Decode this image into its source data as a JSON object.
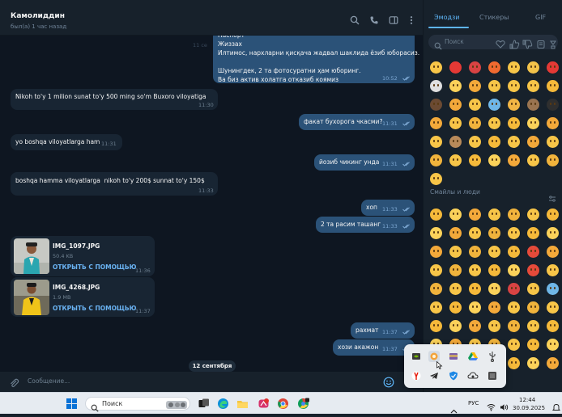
{
  "chat": {
    "name": "Камолиддин",
    "status": "был(а) 1 час назад",
    "input_placeholder": "Сообщение...",
    "date_separator": "12 сентября"
  },
  "messages": [
    {
      "dir": "out",
      "text": "Паспорт\nЖиззах\nИлтимос, нархларни қисқача жадвал шаклида ёзиб юборасиз.\n\nШунингдек, 2 та фотосуратни ҳам юборинг.\nВа биз актив холатга отказиб коямиз",
      "time": "10:52"
    },
    {
      "dir": "in",
      "text": "Nikoh to'y 1 milion sunat to'y 500 ming so'm Buxoro viloyatiga",
      "time": "11:30"
    },
    {
      "dir": "out",
      "text": "факат бухорога чкасми?",
      "time": "11:31"
    },
    {
      "dir": "in",
      "text": "yo boshqa viloyatlarga ham",
      "time": "11:31"
    },
    {
      "dir": "out",
      "text": "йозиб чикинг унда",
      "time": "11:31"
    },
    {
      "dir": "in",
      "text": "boshqa hamma viloyatlarga  nikoh to'y 200$ sunnat to'y 150$",
      "time": "11:33"
    },
    {
      "dir": "out",
      "text": "хоп",
      "time": "11:33"
    },
    {
      "dir": "out",
      "text": "2 та расим ташанг",
      "time": "11:33"
    },
    {
      "dir": "out",
      "text": "рахмат",
      "time": "11:37"
    },
    {
      "dir": "out",
      "text": "хози акажон",
      "time": "11:37"
    }
  ],
  "files": [
    {
      "name": "IMG_1097.JPG",
      "size": "50.4 KB",
      "action": "ОТКРЫТЬ С ПОМОЩЬЮ",
      "time": "11:36"
    },
    {
      "name": "IMG_4268.JPG",
      "size": "1.9 MB",
      "action": "ОТКРЫТЬ С ПОМОЩЬЮ",
      "time": "11:37"
    }
  ],
  "faded_time": "11 се",
  "emoji_panel": {
    "tabs": [
      "Эмодзи",
      "Стикеры",
      "GIF"
    ],
    "search_placeholder": "Поиск",
    "section_title": "Смайлы и люди"
  },
  "taskbar": {
    "search_label": "Поиск",
    "language": "РУС",
    "time": "12:44",
    "date": "30.09.2025"
  },
  "colors": {
    "chat_bg": "#0e1621",
    "panel_bg": "#17212b",
    "incoming": "#182533",
    "outgoing": "#2b5278",
    "accent": "#5eb5f7",
    "link": "#6ab3f3"
  }
}
